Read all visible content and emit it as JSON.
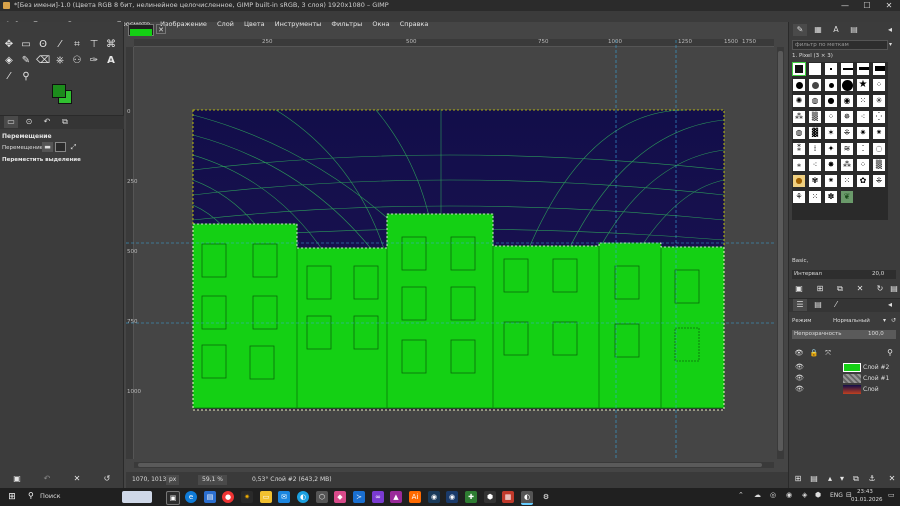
{
  "window": {
    "title": "*[Без имени]-1.0 (Цвета RGB 8 бит, нелинейное целочисленное, GIMP built-in sRGB, 3 слоя) 1920x1080 – GIMP",
    "minimize": "—",
    "maximize": "☐",
    "close": "✕"
  },
  "menu": [
    "Файл",
    "Правка",
    "Выделение",
    "Просмотр",
    "Изображение",
    "Слой",
    "Цвета",
    "Инструменты",
    "Фильтры",
    "Окна",
    "Справка"
  ],
  "tool_options": {
    "title": "Перемещение",
    "move_label": "Перемещение:",
    "move_selection": "Переместить выделение"
  },
  "colors": {
    "foreground": "#1c8c1c",
    "background": "#30c030",
    "building": "#14d014",
    "sky": "#120e4a"
  },
  "rulers": {
    "h": [
      "250",
      "500",
      "750",
      "1000",
      "1250",
      "1500",
      "1750"
    ],
    "v": [
      "0",
      "250",
      "500",
      "750",
      "1000"
    ]
  },
  "brushes": {
    "filter_placeholder": "фильтр по меткам",
    "current": "1. Pixel (3 × 3)",
    "preset": "Basic,",
    "spacing_label": "Интервал",
    "spacing_value": "20,0"
  },
  "layers": {
    "mode_label": "Режим",
    "mode_value": "Нормальный",
    "opacity_label": "Непрозрачность",
    "opacity_value": "100,0",
    "items": [
      {
        "name": "Слой #2",
        "visible": true
      },
      {
        "name": "Слой #1",
        "visible": true
      },
      {
        "name": "Слой",
        "visible": true
      }
    ]
  },
  "status": {
    "coords": "1070, 1013",
    "unit": "px",
    "zoom": "59,1 %",
    "info": "0,53° Слой #2 (643,2 MB)"
  },
  "taskbar": {
    "search": "Поиск",
    "lang": "ENG",
    "time": "23:43",
    "date": "01.01.2026"
  }
}
